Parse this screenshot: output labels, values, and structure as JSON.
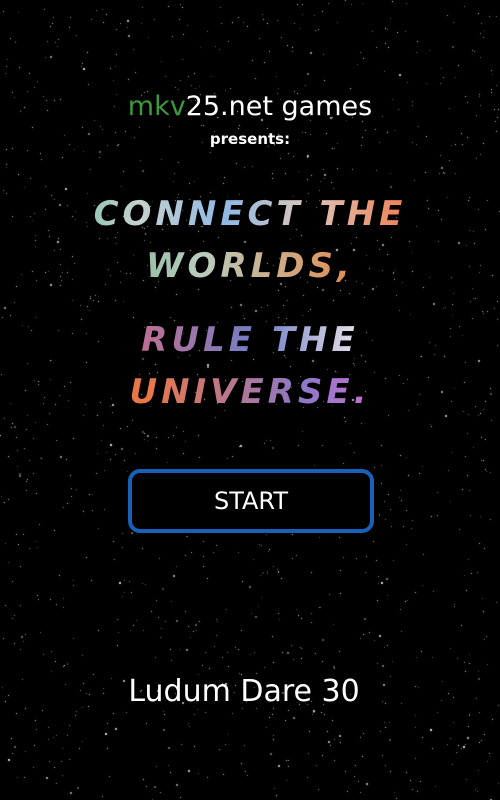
{
  "publisher": {
    "brand_part_1": "mkv",
    "brand_part_2": "25.net games",
    "presents": "presents:"
  },
  "tagline": {
    "line_1": "CONNECT THE",
    "line_2": "WORLDS,",
    "line_3": "RULE THE",
    "line_4": "UNIVERSE."
  },
  "menu": {
    "start_label": "START"
  },
  "footer": {
    "event": "Ludum Dare 30"
  },
  "colors": {
    "background": "#000000",
    "brand_green": "#3c9a3c",
    "button_border": "#1761b8",
    "text": "#ffffff"
  }
}
